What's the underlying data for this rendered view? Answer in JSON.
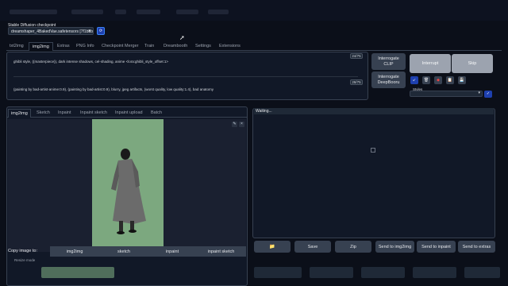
{
  "checkpoint": {
    "label": "Stable Diffusion checkpoint",
    "value": "dreamshaper_4BakedVae.safetensors [7f1bbbcd",
    "refresh_icon": "refresh-icon"
  },
  "tabs": [
    "txt2img",
    "img2img",
    "Extras",
    "PNG Info",
    "Checkpoint Merger",
    "Train",
    "Dreambooth",
    "Settings",
    "Extensions"
  ],
  "active_tab": "img2img",
  "prompt": {
    "positive": "ghibli style, ((masterpiece)), dark intense shadows, cel-shading, anime <lora:ghibli_style_offset:1>",
    "positive_tokens": "24/75",
    "negative": "(painting by bad-artist-anime:0.9), (painting by bad-artist:0.9), blurry, jpeg artifacts, (worst quality, low quality:1.4), bad anatomy",
    "negative_tokens": "28/75"
  },
  "side_buttons": {
    "interrogate_clip": "Interrogate\nCLIP",
    "interrogate_deepbooru": "Interrogate\nDeepBooru",
    "interrupt": "Interrupt",
    "skip": "Skip",
    "styles_label": "Styles"
  },
  "subtabs": [
    "img2img",
    "Sketch",
    "Inpaint",
    "Inpaint sketch",
    "Inpaint upload",
    "Batch"
  ],
  "active_subtab": "img2img",
  "copy_image": {
    "label": "Copy image to:",
    "buttons": [
      "img2img",
      "sketch",
      "inpaint",
      "inpaint sketch"
    ]
  },
  "resize_mode_label": "Resize mode",
  "output": {
    "status": "Waiting...",
    "buttons": [
      "Save",
      "Zip",
      "Send to img2img",
      "Send to inpaint",
      "Send to extras"
    ]
  }
}
